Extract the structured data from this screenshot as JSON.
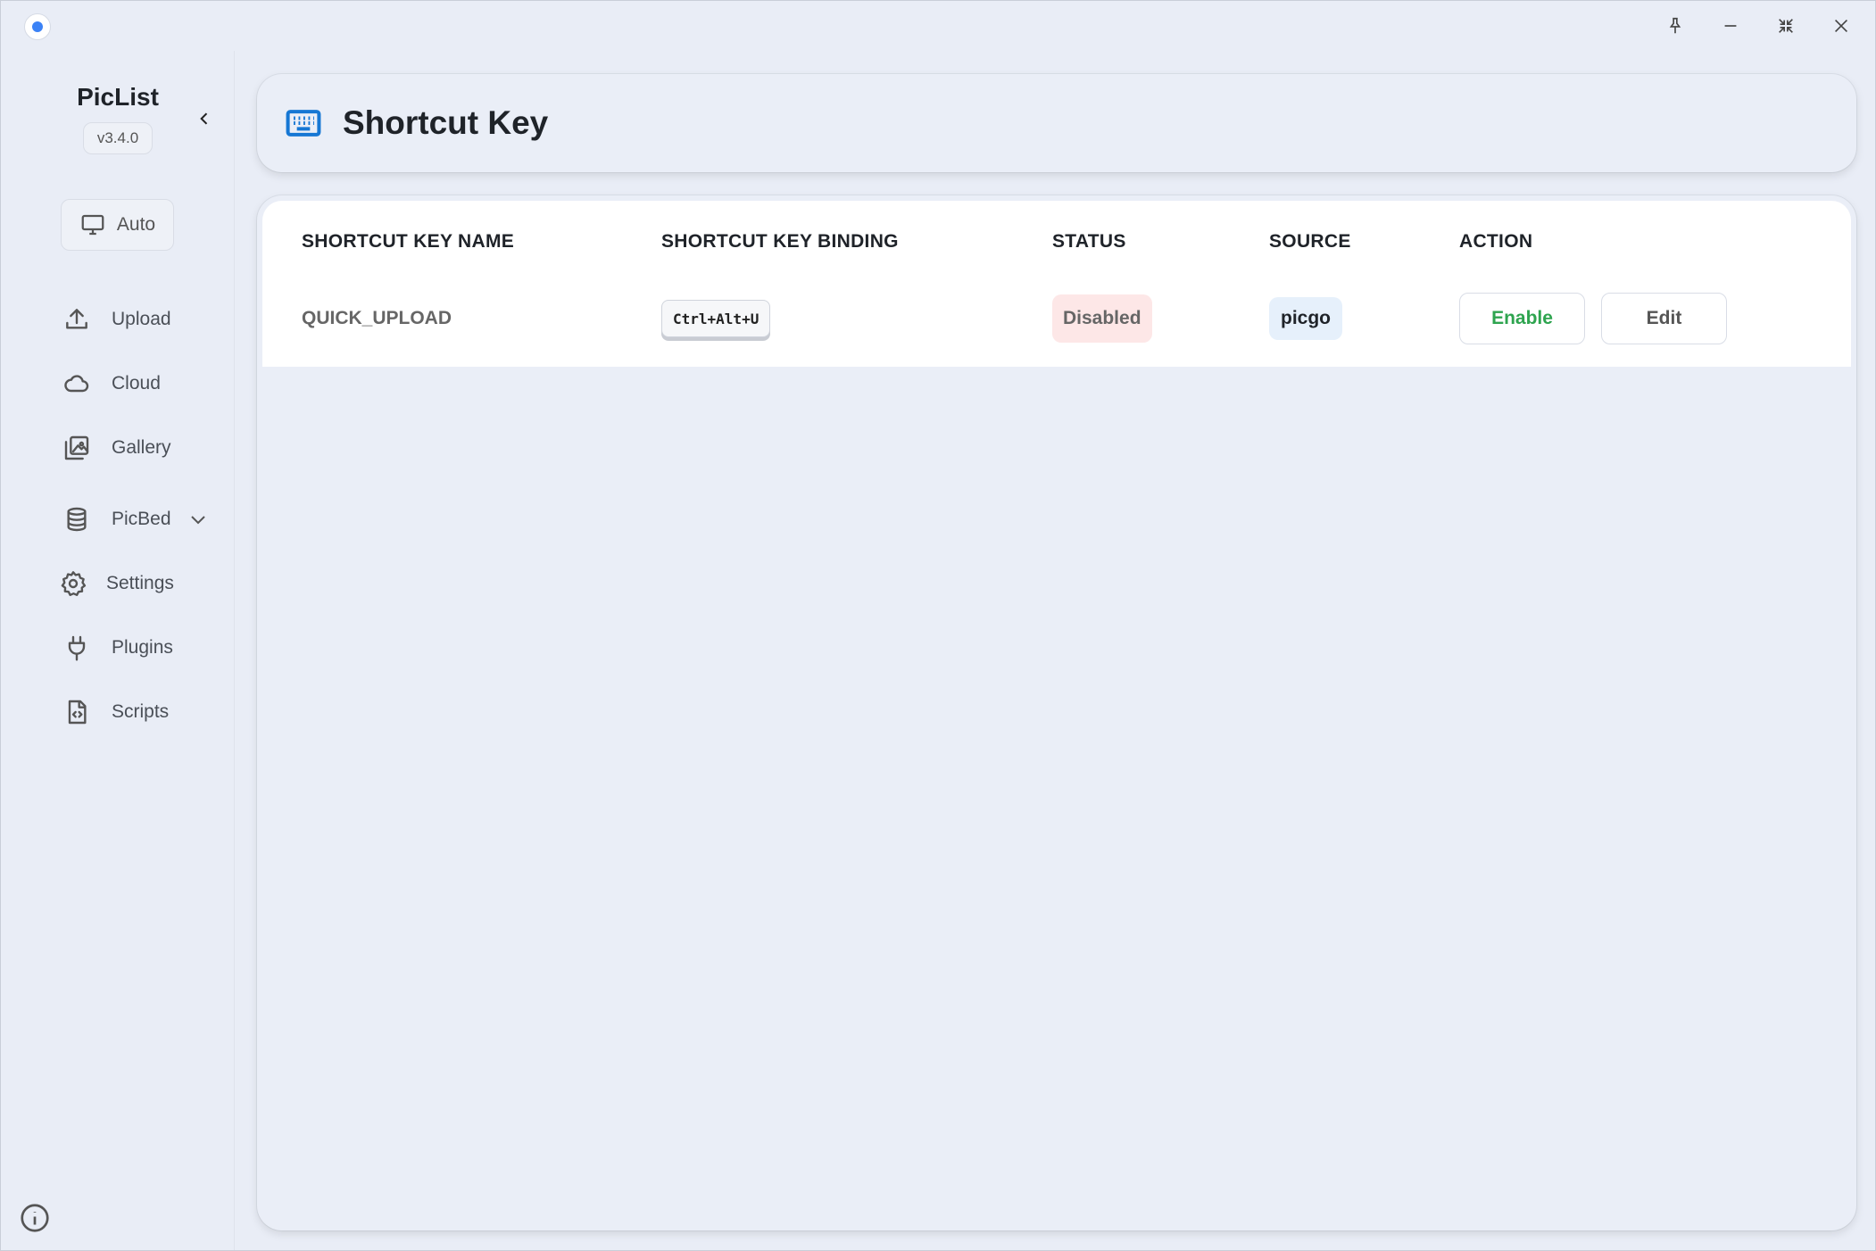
{
  "app": {
    "name": "PicList",
    "version": "v3.4.0",
    "theme_label": "Auto"
  },
  "window_controls": [
    {
      "icon": "pin-icon"
    },
    {
      "icon": "minimize-icon"
    },
    {
      "icon": "shrink-icon"
    },
    {
      "icon": "close-icon"
    }
  ],
  "sidebar": {
    "items": [
      {
        "label": "Upload",
        "icon": "upload-icon"
      },
      {
        "label": "Cloud",
        "icon": "cloud-icon"
      },
      {
        "label": "Gallery",
        "icon": "gallery-icon"
      },
      {
        "label": "PicBed",
        "icon": "database-icon"
      },
      {
        "label": "Settings",
        "icon": "gear-icon"
      },
      {
        "label": "Plugins",
        "icon": "plug-icon"
      },
      {
        "label": "Scripts",
        "icon": "script-file-icon"
      }
    ]
  },
  "header": {
    "title": "Shortcut Key",
    "icon": "keyboard-icon"
  },
  "table": {
    "columns": [
      "SHORTCUT KEY NAME",
      "SHORTCUT KEY BINDING",
      "STATUS",
      "SOURCE",
      "ACTION"
    ],
    "rows": [
      {
        "name": "QUICK_UPLOAD",
        "binding": "Ctrl+Alt+U",
        "status": "Disabled",
        "source": "picgo",
        "actions": [
          "Enable",
          "Edit"
        ]
      }
    ]
  },
  "colors": {
    "accent": "#1677d4",
    "enable_text": "#2ea44f",
    "disabled_bg": "#fde7e7",
    "source_bg": "#e6f0fb",
    "background": "#e9edf6"
  }
}
